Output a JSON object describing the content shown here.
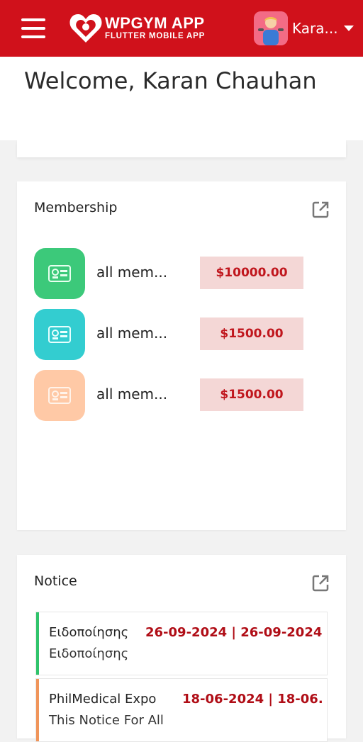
{
  "app": {
    "title": "WPGYM APP",
    "subtitle": "FLUTTER MOBILE APP",
    "user_name": "Kara...",
    "colors": {
      "brand": "#d0111b",
      "price_bg": "#f4d7d6",
      "price_text": "#c0161d"
    }
  },
  "welcome": {
    "text": "Welcome, Karan Chauhan"
  },
  "membership": {
    "title": "Membership",
    "icon": "external-link-icon",
    "items": [
      {
        "name": "all mem...",
        "price": "$10000.00",
        "color": "#3cc97a",
        "icon": "membership-card-icon"
      },
      {
        "name": "all mem...",
        "price": "$1500.00",
        "color": "#33cdd0",
        "icon": "membership-card-icon"
      },
      {
        "name": "all mem...",
        "price": "$1500.00",
        "color": "#ffc9a6",
        "icon": "membership-card-icon"
      }
    ]
  },
  "notice": {
    "title": "Notice",
    "icon": "external-link-icon",
    "items": [
      {
        "title": "Ειδοποίησης",
        "date": "26-09-2024 | 26-09-2024",
        "subtitle": "Ειδοποίησης",
        "color": "#2fc36b"
      },
      {
        "title": "PhilMedical Expo",
        "date": "18-06-2024 | 18-06...",
        "subtitle": "This Notice For All",
        "color": "#f0955a"
      }
    ]
  }
}
